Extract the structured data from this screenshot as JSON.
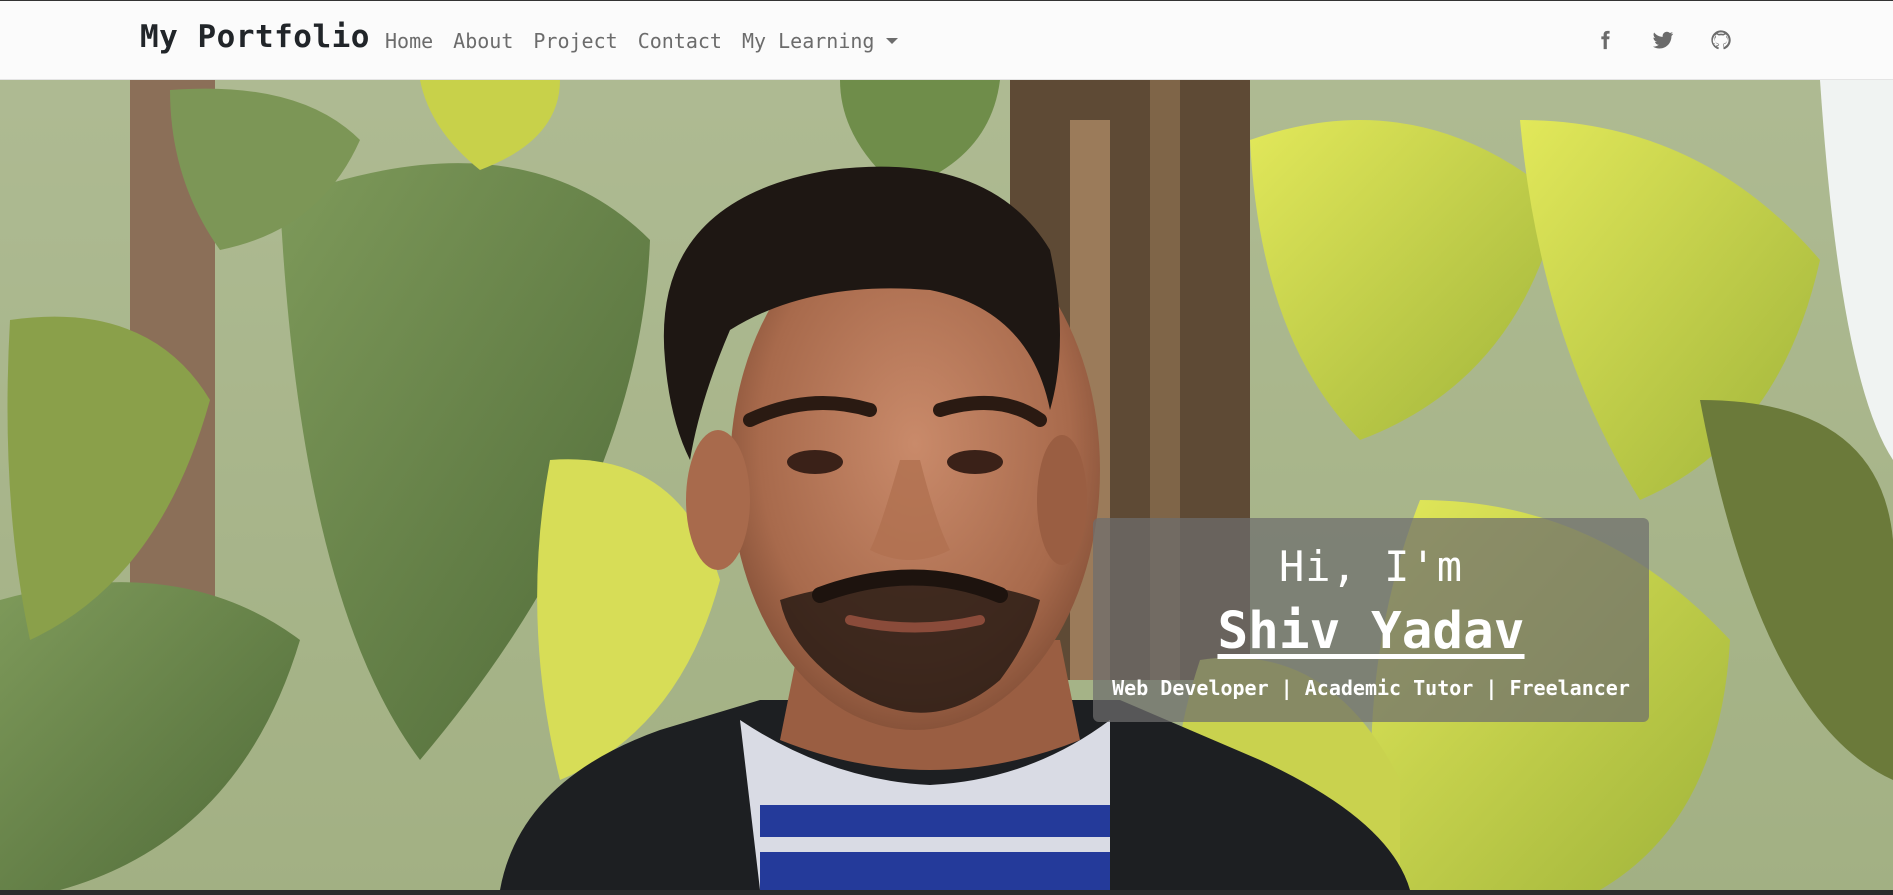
{
  "navbar": {
    "brand": "My Portfolio",
    "links": [
      {
        "label": "Home"
      },
      {
        "label": "About"
      },
      {
        "label": "Project"
      },
      {
        "label": "Contact"
      },
      {
        "label": "My Learning"
      }
    ],
    "social": [
      {
        "icon": "facebook-icon"
      },
      {
        "icon": "twitter-icon"
      },
      {
        "icon": "github-icon"
      }
    ]
  },
  "hero": {
    "greeting": "Hi, I'm",
    "name": "Shiv Yadav",
    "roles": "Web Developer | Academic Tutor | Freelancer"
  },
  "colors": {
    "navbar_bg": "#fbfbfb",
    "text_dark": "#212529",
    "nav_link": "#6c6c6c",
    "card_bg": "rgba(110,110,110,0.72)",
    "card_text": "#ffffff"
  }
}
